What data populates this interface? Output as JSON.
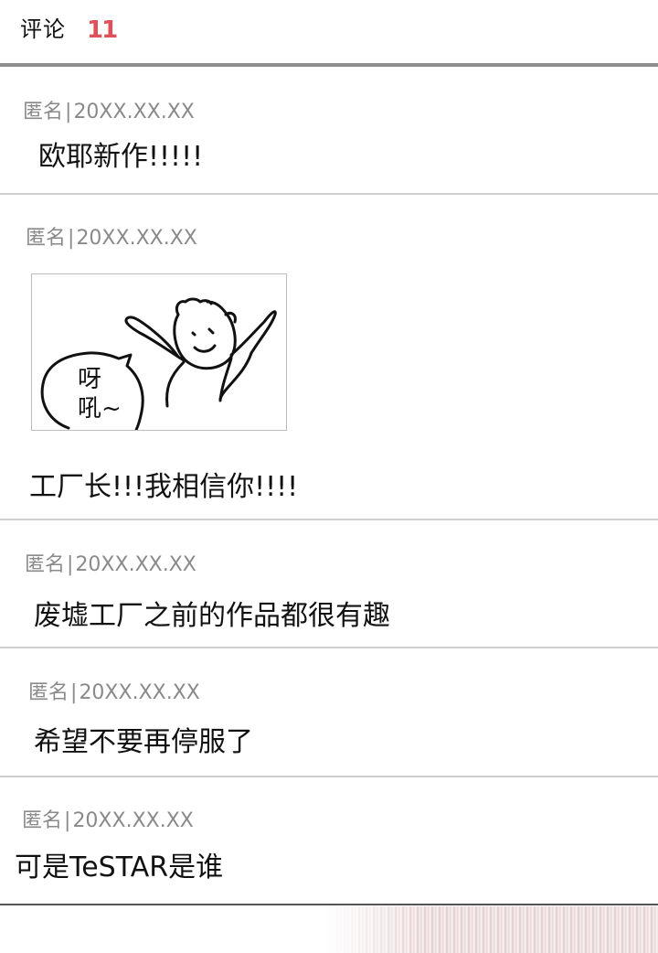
{
  "header": {
    "title": "评论",
    "count": "11"
  },
  "comments": [
    {
      "author": "匿名",
      "separator": "|",
      "date": "20XX.XX.XX",
      "text": "欧耶新作!!!!!"
    },
    {
      "author": "匿名",
      "separator": "|",
      "date": "20XX.XX.XX",
      "text": "工厂长!!!我相信你!!!!",
      "sticker": {
        "bubble_text_1": "呀",
        "bubble_text_2": "吼~"
      }
    },
    {
      "author": "匿名",
      "separator": "|",
      "date": "20XX.XX.XX",
      "text": "废墟工厂之前的作品都很有趣"
    },
    {
      "author": "匿名",
      "separator": "|",
      "date": "20XX.XX.XX",
      "text": "希望不要再停服了"
    },
    {
      "author": "匿名",
      "separator": "|",
      "date": "20XX.XX.XX",
      "text": "可是TeSTAR是谁"
    }
  ],
  "colors": {
    "count_accent": "#e0505a",
    "meta_text": "#8a8a8a",
    "divider": "#cfcfcf"
  }
}
